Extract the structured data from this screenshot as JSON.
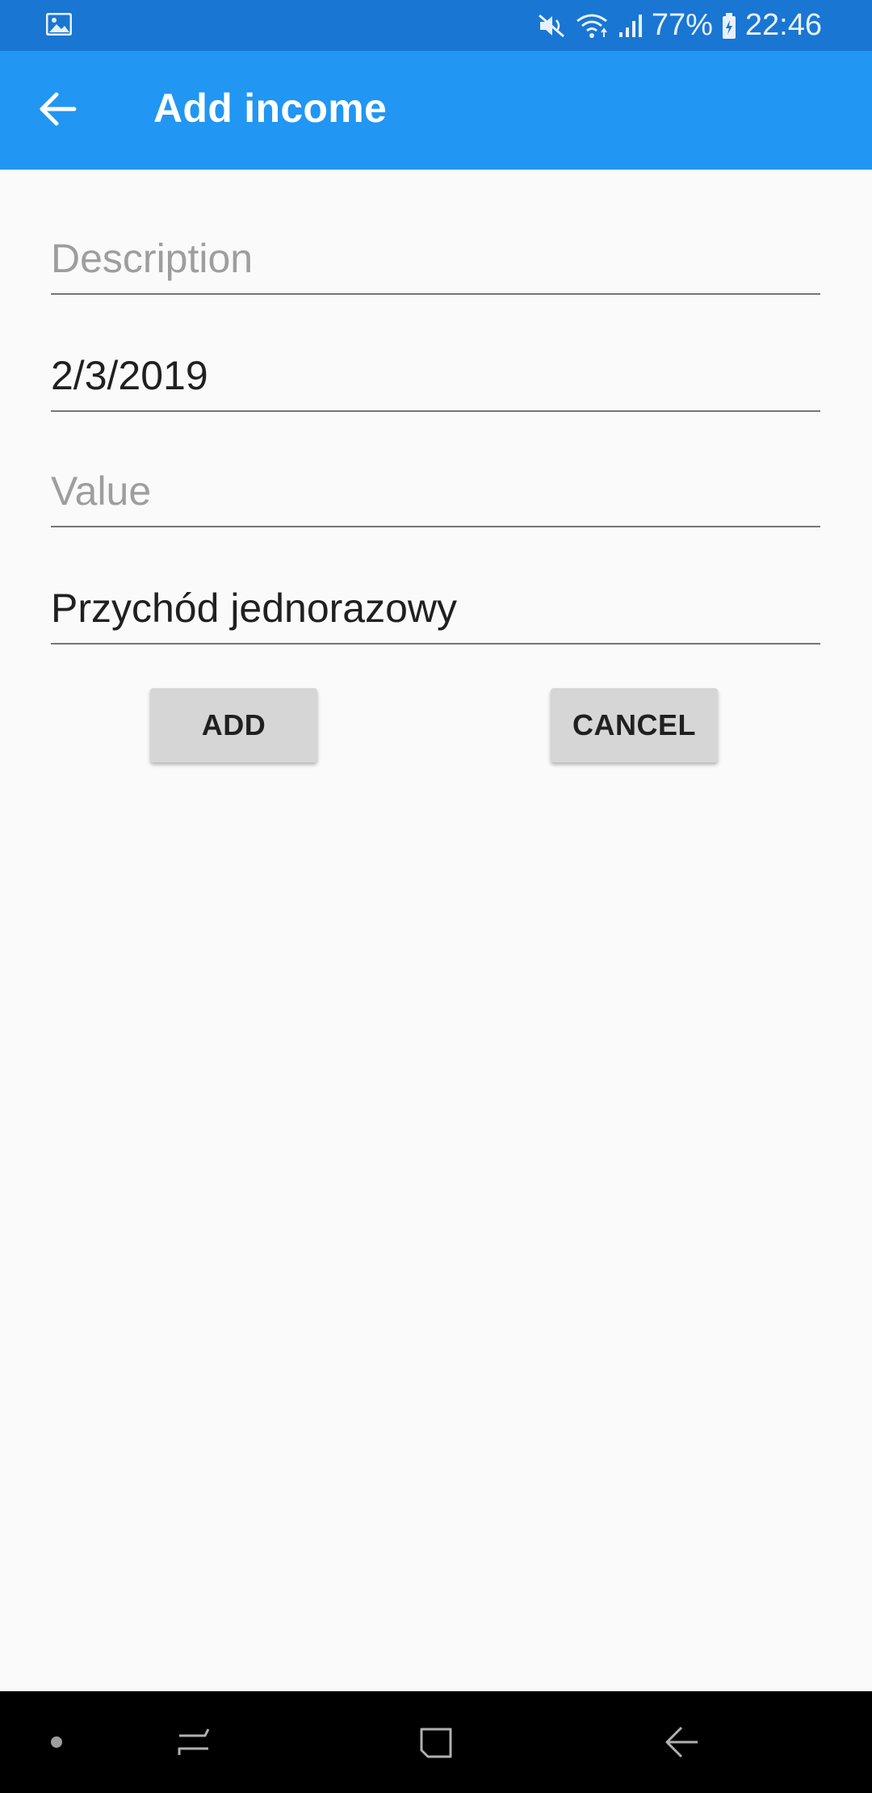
{
  "status_bar": {
    "battery": "77%",
    "time": "22:46"
  },
  "app_bar": {
    "title": "Add income"
  },
  "form": {
    "description_placeholder": "Description",
    "date_value": "2/3/2019",
    "value_placeholder": "Value",
    "type_value": "Przychód jednorazowy"
  },
  "buttons": {
    "add_label": "ADD",
    "cancel_label": "CANCEL"
  },
  "colors": {
    "status_bar": "#1976d2",
    "app_bar": "#2196f3",
    "background": "#fafafa",
    "button": "#d6d6d6"
  },
  "icons": {
    "status_left": "gallery-icon",
    "mute": "mute-icon",
    "wifi": "wifi-icon",
    "signal": "signal-icon",
    "battery": "battery-icon",
    "back": "arrow-back-icon",
    "nav_dot": "nav-dot-icon",
    "nav_recents": "recents-icon",
    "nav_home": "home-icon",
    "nav_back": "nav-back-icon"
  }
}
